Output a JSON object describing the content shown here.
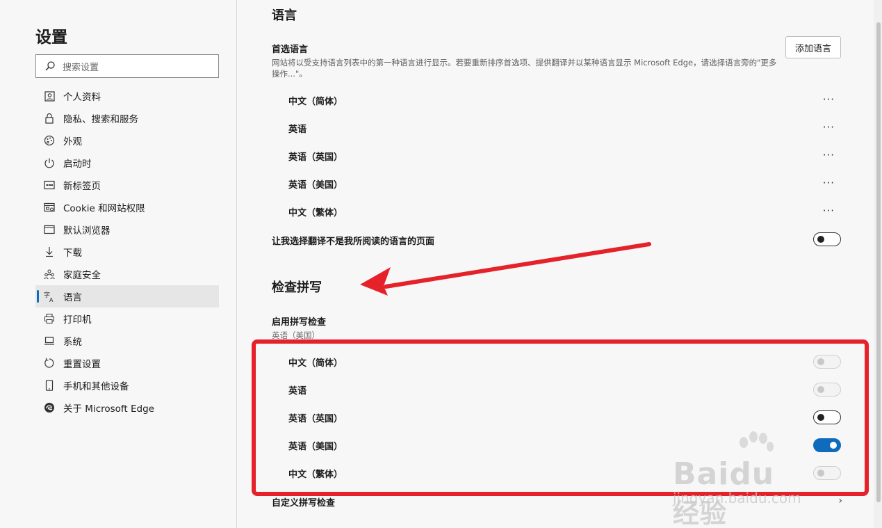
{
  "sidebar": {
    "title": "设置",
    "search_placeholder": "搜索设置",
    "items": [
      {
        "label": "个人资料",
        "icon": "profile-icon"
      },
      {
        "label": "隐私、搜索和服务",
        "icon": "lock-icon"
      },
      {
        "label": "外观",
        "icon": "palette-icon"
      },
      {
        "label": "启动时",
        "icon": "power-icon"
      },
      {
        "label": "新标签页",
        "icon": "newtab-icon"
      },
      {
        "label": "Cookie 和网站权限",
        "icon": "site-permissions-icon"
      },
      {
        "label": "默认浏览器",
        "icon": "browser-icon"
      },
      {
        "label": "下载",
        "icon": "download-icon"
      },
      {
        "label": "家庭安全",
        "icon": "family-icon"
      },
      {
        "label": "语言",
        "icon": "language-icon",
        "active": true
      },
      {
        "label": "打印机",
        "icon": "printer-icon"
      },
      {
        "label": "系统",
        "icon": "system-icon"
      },
      {
        "label": "重置设置",
        "icon": "reset-icon"
      },
      {
        "label": "手机和其他设备",
        "icon": "phone-icon"
      },
      {
        "label": "关于 Microsoft Edge",
        "icon": "edge-logo-icon"
      }
    ]
  },
  "language_section": {
    "heading": "语言",
    "preferred_label": "首选语言",
    "preferred_desc": "网站将以受支持语言列表中的第一种语言进行显示。若要重新排序首选项、提供翻译并以某种语言显示 Microsoft Edge，请选择语言旁的\"更多操作...\"。",
    "add_button": "添加语言",
    "languages": [
      "中文（简体）",
      "英语",
      "英语（英国）",
      "英语（美国）",
      "中文（繁体）"
    ],
    "more_label": "···",
    "translate_label": "让我选择翻译不是我所阅读的语言的页面",
    "translate_on": false
  },
  "spell_section": {
    "heading": "检查拼写",
    "enable_label": "启用拼写检查",
    "enable_sub": "英语（美国）",
    "languages": [
      {
        "label": "中文（简体）",
        "state": "disabled"
      },
      {
        "label": "英语",
        "state": "disabled"
      },
      {
        "label": "英语（英国）",
        "state": "off"
      },
      {
        "label": "英语（美国）",
        "state": "on"
      },
      {
        "label": "中文（繁体）",
        "state": "disabled"
      }
    ],
    "custom_label": "自定义拼写检查",
    "custom_chevron": "›"
  },
  "watermark": {
    "brand": "Bai",
    "brand2": "du",
    "suffix": "经验",
    "url": "jingyan.baidu.com"
  },
  "colors": {
    "accent": "#0f6cbd",
    "annotation_red": "#e52229"
  }
}
